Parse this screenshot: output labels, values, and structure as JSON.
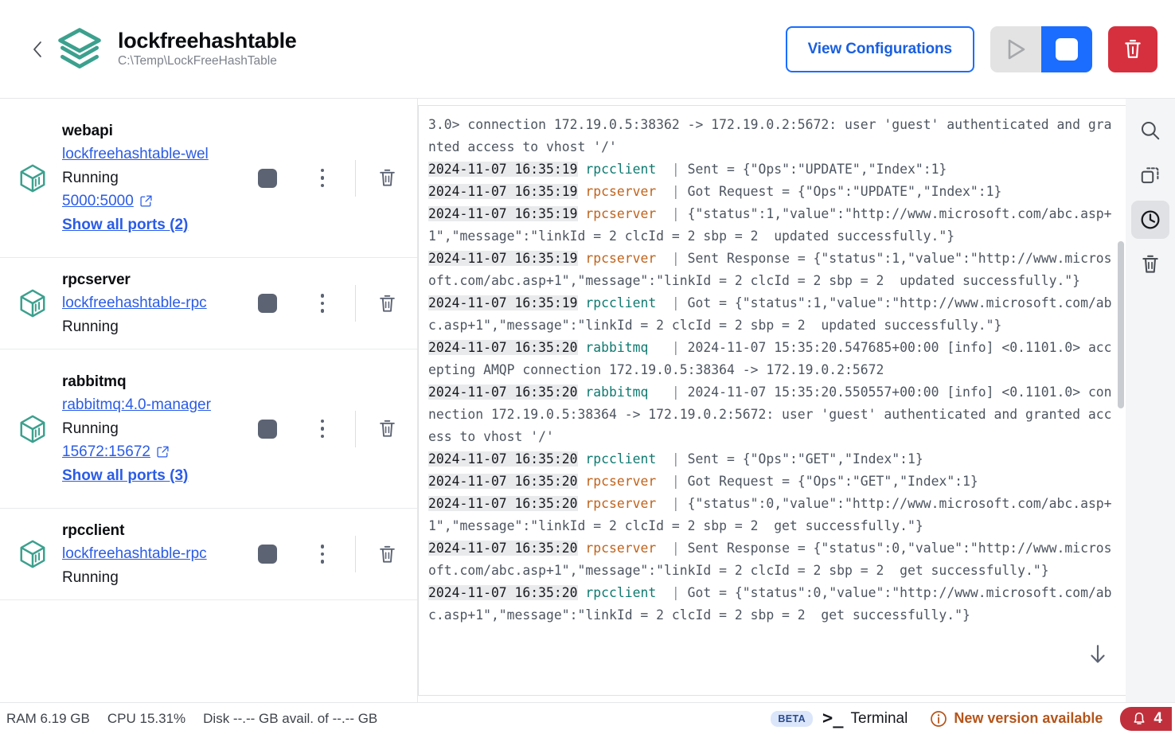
{
  "header": {
    "back_icon": "chevron-left-icon",
    "logo_icon": "docker-compose-stack-icon",
    "project_title": "lockfreehashtable",
    "project_path": "C:\\Temp\\LockFreeHashTable",
    "view_configurations_label": "View Configurations",
    "play_icon": "play-icon",
    "stop_icon": "stop-icon",
    "delete_icon": "trash-icon",
    "accent_blue": "#1a6dff",
    "danger_red": "#d6303e"
  },
  "sidebar": {
    "containers": [
      {
        "name": "webapi",
        "image": "lockfreehashtable-wel",
        "status": "Running",
        "port": "5000:5000",
        "show_all_ports": "Show all ports (2)",
        "has_ports": true,
        "stop_icon": "stop-icon",
        "menu_icon": "kebab-menu-icon",
        "delete_icon": "trash-icon",
        "container_icon": "container-cube-icon"
      },
      {
        "name": "rpcserver",
        "image": "lockfreehashtable-rpc",
        "status": "Running",
        "port": "",
        "show_all_ports": "",
        "has_ports": false,
        "stop_icon": "stop-icon",
        "menu_icon": "kebab-menu-icon",
        "delete_icon": "trash-icon",
        "container_icon": "container-cube-icon"
      },
      {
        "name": "rabbitmq",
        "image": "rabbitmq:4.0-manager",
        "status": "Running",
        "port": "15672:15672",
        "show_all_ports": "Show all ports (3)",
        "has_ports": true,
        "stop_icon": "stop-icon",
        "menu_icon": "kebab-menu-icon",
        "delete_icon": "trash-icon",
        "container_icon": "container-cube-icon"
      },
      {
        "name": "rpcclient",
        "image": "lockfreehashtable-rpc",
        "status": "Running",
        "port": "",
        "show_all_ports": "",
        "has_ports": false,
        "stop_icon": "stop-icon",
        "menu_icon": "kebab-menu-icon",
        "delete_icon": "trash-icon",
        "container_icon": "container-cube-icon"
      }
    ]
  },
  "logs": {
    "lines": [
      {
        "ts": "",
        "svc": "",
        "text": "3.0> connection 172.19.0.5:38362 -> 172.19.0.2:5672: user 'guest' authenticated and granted access to vhost '/'"
      },
      {
        "ts": "2024-11-07 16:35:19",
        "svc": "rpcclient",
        "svc_class": "svc-rpcclient",
        "text": "Sent = {\"Ops\":\"UPDATE\",\"Index\":1}"
      },
      {
        "ts": "2024-11-07 16:35:19",
        "svc": "rpcserver",
        "svc_class": "svc-rpcserver",
        "text": "Got Request = {\"Ops\":\"UPDATE\",\"Index\":1}"
      },
      {
        "ts": "2024-11-07 16:35:19",
        "svc": "rpcserver",
        "svc_class": "svc-rpcserver",
        "text": "{\"status\":1,\"value\":\"http://www.microsoft.com/abc.asp+1\",\"message\":\"linkId = 2 clcId = 2 sbp = 2  updated successfully.\"}"
      },
      {
        "ts": "2024-11-07 16:35:19",
        "svc": "rpcserver",
        "svc_class": "svc-rpcserver",
        "text": "Sent Response = {\"status\":1,\"value\":\"http://www.microsoft.com/abc.asp+1\",\"message\":\"linkId = 2 clcId = 2 sbp = 2  updated successfully.\"}"
      },
      {
        "ts": "2024-11-07 16:35:19",
        "svc": "rpcclient",
        "svc_class": "svc-rpcclient",
        "text": "Got = {\"status\":1,\"value\":\"http://www.microsoft.com/abc.asp+1\",\"message\":\"linkId = 2 clcId = 2 sbp = 2  updated successfully.\"}"
      },
      {
        "ts": "2024-11-07 16:35:20",
        "svc": "rabbitmq",
        "svc_class": "svc-rabbitmq",
        "text": "2024-11-07 15:35:20.547685+00:00 [info] <0.1101.0> accepting AMQP connection 172.19.0.5:38364 -> 172.19.0.2:5672"
      },
      {
        "ts": "2024-11-07 16:35:20",
        "svc": "rabbitmq",
        "svc_class": "svc-rabbitmq",
        "text": "2024-11-07 15:35:20.550557+00:00 [info] <0.1101.0> connection 172.19.0.5:38364 -> 172.19.0.2:5672: user 'guest' authenticated and granted access to vhost '/'"
      },
      {
        "ts": "2024-11-07 16:35:20",
        "svc": "rpcclient",
        "svc_class": "svc-rpcclient",
        "text": "Sent = {\"Ops\":\"GET\",\"Index\":1}"
      },
      {
        "ts": "2024-11-07 16:35:20",
        "svc": "rpcserver",
        "svc_class": "svc-rpcserver",
        "text": "Got Request = {\"Ops\":\"GET\",\"Index\":1}"
      },
      {
        "ts": "2024-11-07 16:35:20",
        "svc": "rpcserver",
        "svc_class": "svc-rpcserver",
        "text": "{\"status\":0,\"value\":\"http://www.microsoft.com/abc.asp+1\",\"message\":\"linkId = 2 clcId = 2 sbp = 2  get successfully.\"}"
      },
      {
        "ts": "2024-11-07 16:35:20",
        "svc": "rpcserver",
        "svc_class": "svc-rpcserver",
        "text": "Sent Response = {\"status\":0,\"value\":\"http://www.microsoft.com/abc.asp+1\",\"message\":\"linkId = 2 clcId = 2 sbp = 2  get successfully.\"}"
      },
      {
        "ts": "2024-11-07 16:35:20",
        "svc": "rpcclient",
        "svc_class": "svc-rpcclient",
        "text": "Got = {\"status\":0,\"value\":\"http://www.microsoft.com/abc.asp+1\",\"message\":\"linkId = 2 clcId = 2 sbp = 2  get successfully.\"}"
      }
    ],
    "jump_to_bottom_icon": "arrow-down-icon"
  },
  "rail": {
    "buttons": [
      {
        "icon": "search-icon",
        "active": false
      },
      {
        "icon": "copy-icon",
        "active": false
      },
      {
        "icon": "clock-icon",
        "active": true
      },
      {
        "icon": "trash-icon",
        "active": false
      }
    ]
  },
  "statusbar": {
    "ram": "RAM 6.19 GB",
    "cpu": "CPU 15.31%",
    "disk": "Disk --.-- GB avail. of --.-- GB",
    "beta_badge": "BETA",
    "terminal_label": "Terminal",
    "terminal_glyph": ">_",
    "new_version_label": "New version available",
    "new_version_icon": "info-circle-icon",
    "notification_count": "4",
    "notification_icon": "bell-icon"
  }
}
